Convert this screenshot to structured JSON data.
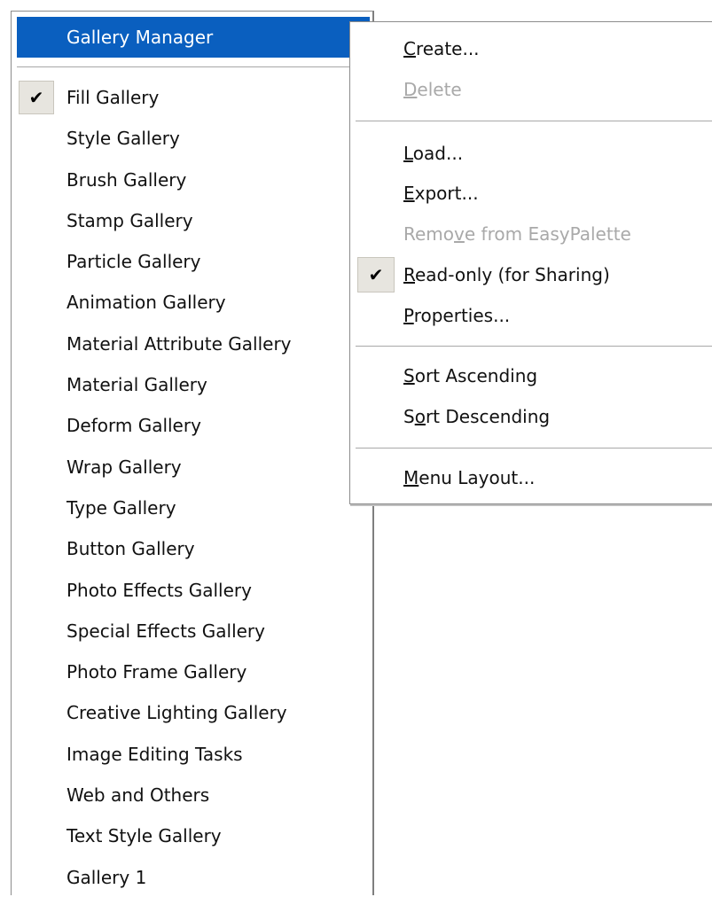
{
  "left_menu": {
    "header": "Gallery Manager",
    "check_icon": "✔",
    "items": [
      {
        "label": "Fill Gallery",
        "checked": true
      },
      {
        "label": "Style Gallery",
        "checked": false
      },
      {
        "label": "Brush Gallery",
        "checked": false
      },
      {
        "label": "Stamp Gallery",
        "checked": false
      },
      {
        "label": "Particle Gallery",
        "checked": false
      },
      {
        "label": "Animation Gallery",
        "checked": false
      },
      {
        "label": "Material Attribute Gallery",
        "checked": false
      },
      {
        "label": "Material Gallery",
        "checked": false
      },
      {
        "label": "Deform Gallery",
        "checked": false
      },
      {
        "label": "Wrap Gallery",
        "checked": false
      },
      {
        "label": "Type Gallery",
        "checked": false
      },
      {
        "label": "Button Gallery",
        "checked": false
      },
      {
        "label": "Photo Effects Gallery",
        "checked": false
      },
      {
        "label": "Special Effects Gallery",
        "checked": false
      },
      {
        "label": "Photo Frame Gallery",
        "checked": false
      },
      {
        "label": "Creative Lighting Gallery",
        "checked": false
      },
      {
        "label": "Image Editing Tasks",
        "checked": false
      },
      {
        "label": "Web and Others",
        "checked": false
      },
      {
        "label": "Text Style Gallery",
        "checked": false
      },
      {
        "label": "Gallery 1",
        "checked": false
      }
    ]
  },
  "submenu": {
    "check_icon": "✔",
    "items": {
      "create": {
        "pre": "",
        "mnemonic": "C",
        "post": "reate...",
        "enabled": true
      },
      "delete": {
        "pre": "",
        "mnemonic": "D",
        "post": "elete",
        "enabled": false
      },
      "load": {
        "pre": "",
        "mnemonic": "L",
        "post": "oad...",
        "enabled": true
      },
      "export": {
        "pre": "",
        "mnemonic": "E",
        "post": "xport...",
        "enabled": true
      },
      "remove": {
        "pre": "Remo",
        "mnemonic": "v",
        "post": "e from EasyPalette",
        "enabled": false
      },
      "read_only": {
        "pre": "",
        "mnemonic": "R",
        "post": "ead-only (for Sharing)",
        "enabled": true,
        "checked": true
      },
      "properties": {
        "pre": "",
        "mnemonic": "P",
        "post": "roperties...",
        "enabled": true
      },
      "sort_ascending": {
        "pre": "",
        "mnemonic": "S",
        "post": "ort Ascending",
        "enabled": true
      },
      "sort_descending": {
        "pre": "S",
        "mnemonic": "o",
        "post": "rt Descending",
        "enabled": true
      },
      "menu_layout": {
        "pre": "",
        "mnemonic": "M",
        "post": "enu Layout...",
        "enabled": true
      }
    }
  },
  "colors": {
    "highlight": "#0a5fbf",
    "disabled_text": "#a9a9a9",
    "check_background": "#e7e5df"
  }
}
